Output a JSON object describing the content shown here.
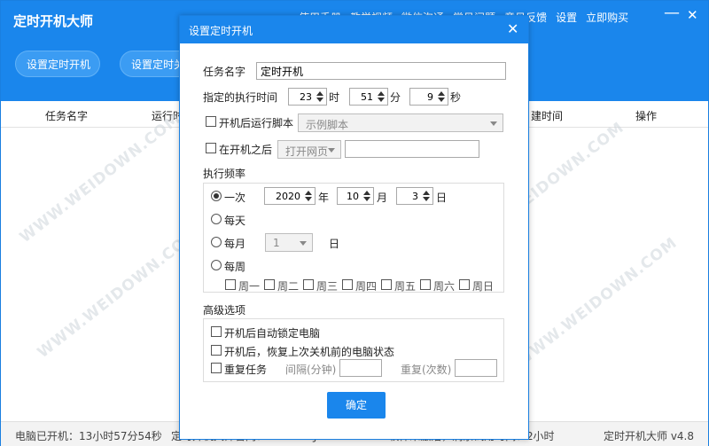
{
  "app": {
    "title": "定时开机大师",
    "nav": [
      "使用手册",
      "教学视频",
      "微信沟通",
      "常见问题",
      "意见反馈",
      "设置",
      "立即购买"
    ],
    "minimize_glyph": "—",
    "close_glyph": "✕",
    "buttons": {
      "set_boot": "设置定时开机",
      "set_shutdown": "设置定时关"
    },
    "columns": {
      "name": "任务名字",
      "run": "运行时",
      "time": "建时间",
      "op": "操作"
    },
    "watermark": "WWW.WEIDOWN.COM"
  },
  "status": {
    "uptime": "电脑已开机：13小时57分54秒",
    "website": "定时开机大师官网：www.kaijidashi.com 软件未激活，剩余试用时间：2小时",
    "version": "定时开机大师 v4.8"
  },
  "dialog": {
    "title": "设置定时开机",
    "close_glyph": "✕",
    "task_name_label": "任务名字",
    "task_name_value": "定时开机",
    "exec_time_label": "指定的执行时间",
    "hour": "23",
    "hour_unit": "时",
    "minute": "51",
    "minute_unit": "分",
    "second": "9",
    "second_unit": "秒",
    "run_script_label": "开机后运行脚本",
    "script_select": "示例脚本",
    "after_boot_label": "在开机之后",
    "after_boot_select": "打开网页",
    "after_boot_value": "",
    "frequency_label": "执行频率",
    "once_label": "一次",
    "year": "2020",
    "year_unit": "年",
    "month": "10",
    "month_unit": "月",
    "day": "3",
    "day_unit": "日",
    "daily_label": "每天",
    "monthly_label": "每月",
    "monthly_select": "1",
    "monthly_unit": "日",
    "weekly_label": "每周",
    "weekdays": [
      "周一",
      "周二",
      "周三",
      "周四",
      "周五",
      "周六",
      "周日"
    ],
    "advanced_label": "高级选项",
    "adv_lock": "开机后自动锁定电脑",
    "adv_restore": "开机后，恢复上次关机前的电脑状态",
    "adv_repeat": "重复任务",
    "interval_label": "间隔(分钟)",
    "interval_value": "",
    "repeat_count_label": "重复(次数)",
    "repeat_count_value": "",
    "confirm": "确定"
  },
  "colors": {
    "primary": "#1a86ec",
    "pill": "#3b9cf3"
  }
}
